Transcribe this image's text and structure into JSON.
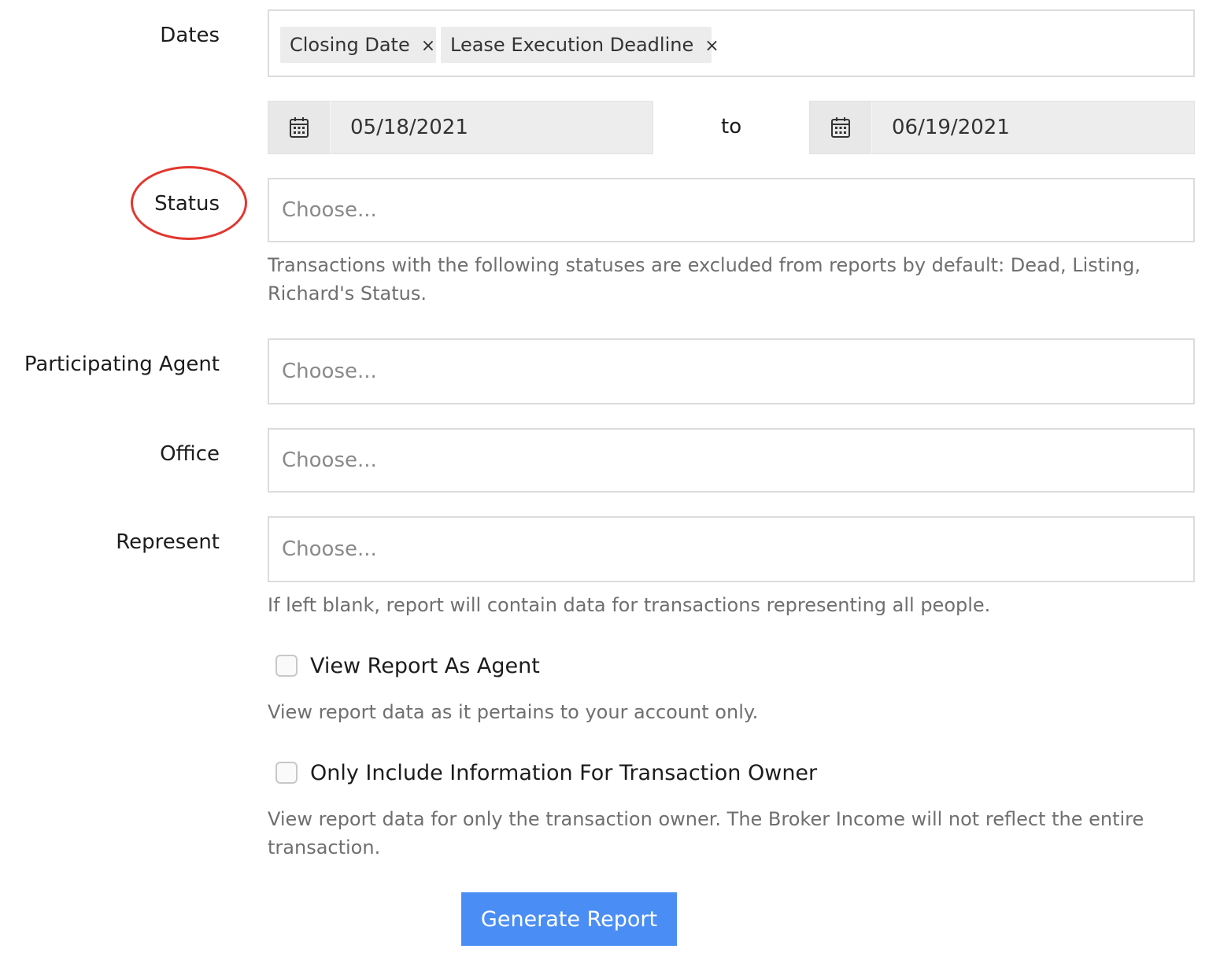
{
  "form": {
    "dates": {
      "label": "Dates",
      "tags": [
        {
          "label": "Closing Date",
          "remove": "×"
        },
        {
          "label": "Lease Execution Deadline",
          "remove": "×"
        }
      ],
      "start_date": "05/18/2021",
      "separator": "to",
      "end_date": "06/19/2021"
    },
    "status": {
      "label": "Status",
      "placeholder": "Choose...",
      "help": "Transactions with the following statuses are excluded from reports by default: Dead, Listing, Richard's Status.",
      "annotation_color": "#e3362d"
    },
    "participating_agent": {
      "label": "Participating Agent",
      "placeholder": "Choose..."
    },
    "office": {
      "label": "Office",
      "placeholder": "Choose..."
    },
    "represent": {
      "label": "Represent",
      "placeholder": "Choose...",
      "help": "If left blank, report will contain data for transactions representing all people."
    },
    "view_as_agent": {
      "label": "View Report As Agent",
      "checked": false,
      "help": "View report data as it pertains to your account only."
    },
    "owner_only": {
      "label": "Only Include Information For Transaction Owner",
      "checked": false,
      "help": "View report data for only the transaction owner. The Broker Income will not reflect the entire transaction."
    },
    "submit_label": "Generate Report"
  },
  "colors": {
    "accent": "#4a8ef5",
    "help_text": "#6f6f6f",
    "placeholder": "#8a8a8a"
  }
}
